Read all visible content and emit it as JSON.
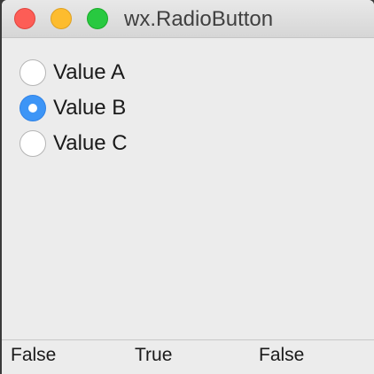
{
  "window": {
    "title": "wx.RadioButton"
  },
  "radios": [
    {
      "label": "Value A",
      "checked": false
    },
    {
      "label": "Value B",
      "checked": true
    },
    {
      "label": "Value C",
      "checked": false
    }
  ],
  "statusbar": {
    "fields": [
      "False",
      "True",
      "False"
    ]
  },
  "colors": {
    "accent": "#3d95f6",
    "close": "#fd5d56",
    "minimize": "#fdbc2e",
    "zoom": "#28c940"
  }
}
